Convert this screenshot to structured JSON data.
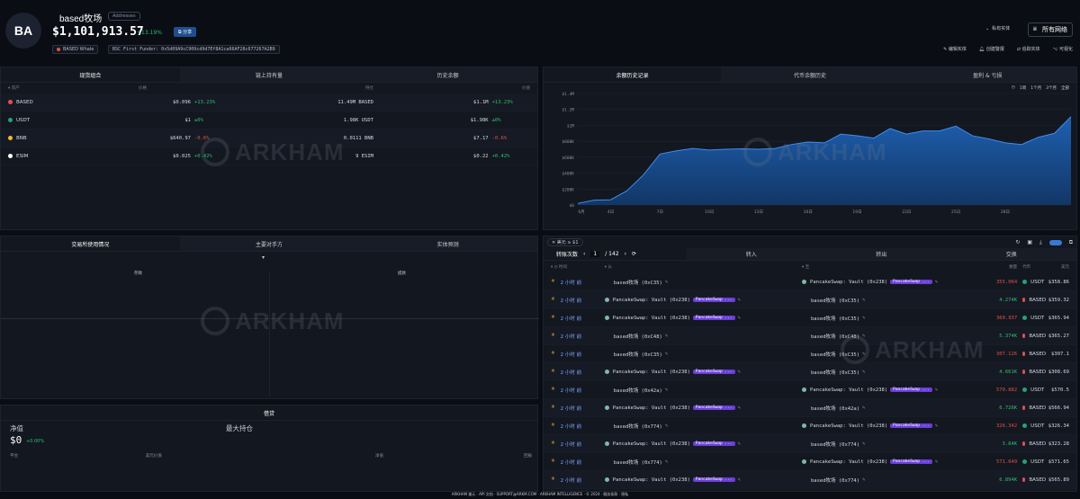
{
  "header": {
    "avatar": "BA",
    "entity_name": "based牧场",
    "address_badge": "Addresses",
    "balance": "$1,101,913.57",
    "change_pct": "+13.19%",
    "share": "分享",
    "tag_whale": "BASED Whale",
    "tag_funder": "BSC First Funder: 0x5d09A9cC909cd9d7Ef8A1ca66AF28c677267A2B9",
    "private_label": "私有实体",
    "all_networks": "所有网络",
    "actions": [
      "编辑实体",
      "创建警报",
      "追踪实体",
      "可视化"
    ]
  },
  "holdings": {
    "tabs": [
      "现货组合",
      "链上持有量",
      "历史余额"
    ],
    "columns": [
      "资产",
      "价格",
      "持仓",
      "价值"
    ],
    "rows": [
      {
        "asset": "BASED",
        "price": "$0.096",
        "change": "+13.23%",
        "holding": "11.49M BASED",
        "value": "$1.1M",
        "vchange": "+13.23%",
        "color": "#e0524c",
        "up": true
      },
      {
        "asset": "USDT",
        "price": "$1",
        "change": "±0%",
        "holding": "1.98K USDT",
        "value": "$1.98K",
        "vchange": "±0%",
        "color": "#26a17b",
        "up": true
      },
      {
        "asset": "BNB",
        "price": "$640.97",
        "change": "-0.6%",
        "holding": "0.0111 BNB",
        "value": "$7.17",
        "vchange": "-0.6%",
        "color": "#f3ba2f",
        "up": false
      },
      {
        "asset": "ESIM",
        "price": "$0.025",
        "change": "+0.42%",
        "holding": "9 ESIM",
        "value": "$0.22",
        "vchange": "+0.42%",
        "color": "#ffffff",
        "up": true
      }
    ]
  },
  "balance_chart": {
    "tabs": [
      "余额历史记录",
      "代币余额历史",
      "盈利 & 亏损"
    ],
    "range_options": [
      "1周",
      "1个月",
      "3个月",
      "全部"
    ],
    "chart_data": {
      "type": "area",
      "yticks": [
        "$0",
        "$200K",
        "$400K",
        "$600K",
        "$800K",
        "$1M",
        "$1.2M",
        "$1.4M"
      ],
      "ylim": [
        0,
        1400000
      ],
      "xticks": [
        "6月",
        "4日",
        "7日",
        "10日",
        "13日",
        "16日",
        "19日",
        "22日",
        "25日",
        "28日"
      ],
      "values": [
        20000,
        60000,
        65000,
        180000,
        380000,
        640000,
        680000,
        710000,
        690000,
        700000,
        705000,
        700000,
        710000,
        760000,
        790000,
        780000,
        890000,
        870000,
        840000,
        960000,
        890000,
        930000,
        930000,
        990000,
        870000,
        830000,
        780000,
        760000,
        850000,
        900000,
        1110000
      ]
    }
  },
  "exchange": {
    "tabs": [
      "交易所使用情况",
      "主要对手方",
      "实体预测"
    ],
    "col_left": "存款",
    "col_right": "提款"
  },
  "lending": {
    "title": "借贷",
    "net_label": "净值",
    "max_label": "最大持仓",
    "net_value": "$0",
    "net_change": "+0.00%",
    "cols": [
      "平台",
      "美元价值",
      "净值",
      "回报"
    ]
  },
  "transfers": {
    "filter": "美元 ≥ $1",
    "tabs": [
      "转账次数",
      "转入",
      "转出",
      "交换"
    ],
    "page": "1",
    "total_pages": "/ 142",
    "cols": [
      "时间",
      "从",
      "至",
      "数量",
      "代币",
      "美元"
    ],
    "rows": [
      {
        "time": "2 小时 前",
        "from": "based牧场 (0xC35)",
        "from_pill": "",
        "to": "PancakeSwap: Vault (0x238)",
        "to_pill": "PancakeSwap ...",
        "amount": "355.064",
        "token": "USDT",
        "usd": "$358.86",
        "neg": true
      },
      {
        "time": "2 小时 前",
        "from": "PancakeSwap: Vault (0x238)",
        "from_pill": "PancakeSwap ...",
        "to": "based牧场 (0xC35)",
        "to_pill": "",
        "amount": "4.274K",
        "token": "BASED",
        "usd": "$359.32",
        "neg": false
      },
      {
        "time": "2 小时 前",
        "from": "PancakeSwap: Vault (0x238)",
        "from_pill": "PancakeSwap ...",
        "to": "based牧场 (0xC35)",
        "to_pill": "",
        "amount": "360.937",
        "token": "USDT",
        "usd": "$365.94",
        "neg": true
      },
      {
        "time": "2 小时 前",
        "from": "based牧场 (0xC48)",
        "from_pill": "",
        "to": "based牧场 (0xC48)",
        "to_pill": "",
        "amount": "5.374K",
        "token": "BASED",
        "usd": "$365.27",
        "neg": false
      },
      {
        "time": "2 小时 前",
        "from": "based牧场 (0xC35)",
        "from_pill": "",
        "to": "based牧场 (0xC35)",
        "to_pill": "",
        "amount": "307.126",
        "token": "BASED",
        "usd": "$307.1",
        "neg": true
      },
      {
        "time": "2 小时 前",
        "from": "PancakeSwap: Vault (0x238)",
        "from_pill": "PancakeSwap ...",
        "to": "based牧场 (0xC35)",
        "to_pill": "",
        "amount": "4.661K",
        "token": "BASED",
        "usd": "$308.69",
        "neg": false
      },
      {
        "time": "2 小时 前",
        "from": "based牧场 (0x42a)",
        "from_pill": "",
        "to": "PancakeSwap: Vault (0x238)",
        "to_pill": "PancakeSwap ...",
        "amount": "570.882",
        "token": "USDT",
        "usd": "$570.5",
        "neg": true
      },
      {
        "time": "2 小时 前",
        "from": "PancakeSwap: Vault (0x238)",
        "from_pill": "PancakeSwap ...",
        "to": "based牧场 (0x42a)",
        "to_pill": "",
        "amount": "6.726K",
        "token": "BASED",
        "usd": "$566.94",
        "neg": false
      },
      {
        "time": "2 小时 前",
        "from": "based牧场 (0x774)",
        "from_pill": "",
        "to": "PancakeSwap: Vault (0x238)",
        "to_pill": "PancakeSwap ...",
        "amount": "326.342",
        "token": "USDT",
        "usd": "$326.34",
        "neg": true
      },
      {
        "time": "2 小时 前",
        "from": "PancakeSwap: Vault (0x238)",
        "from_pill": "PancakeSwap ...",
        "to": "based牧场 (0x774)",
        "to_pill": "",
        "amount": "3.84K",
        "token": "BASED",
        "usd": "$323.28",
        "neg": false
      },
      {
        "time": "2 小时 前",
        "from": "based牧场 (0x774)",
        "from_pill": "",
        "to": "PancakeSwap: Vault (0x238)",
        "to_pill": "PancakeSwap ...",
        "amount": "571.649",
        "token": "USDT",
        "usd": "$571.65",
        "neg": true
      },
      {
        "time": "2 小时 前",
        "from": "PancakeSwap: Vault (0x238)",
        "from_pill": "PancakeSwap ...",
        "to": "based牧场 (0x774)",
        "to_pill": "",
        "amount": "6.894K",
        "token": "BASED",
        "usd": "$565.89",
        "neg": false
      }
    ]
  },
  "watermark": "ARKHAM",
  "footer": "ARKHAM 美元 · API 文档 · SUPPORT@ARKM.COM · ARKHAM INTELLIGENCE · © 2024 · 服务条款 · 隐私"
}
